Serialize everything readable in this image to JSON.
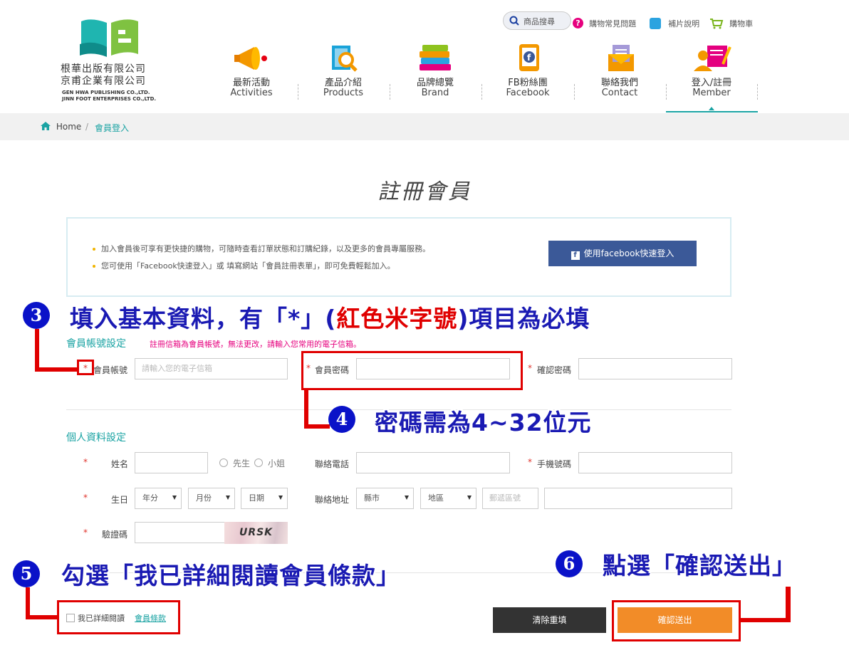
{
  "header": {
    "logo_zh_line1": "根華出版有限公司",
    "logo_zh_line2": "京甫企業有限公司",
    "logo_en_line1": "GEN HWA PUBLISHING CO.,LTD.",
    "logo_en_line2": "JINN FOOT ENTERPRISES CO.,LTD.",
    "search_placeholder": "商品搜尋",
    "top_links": [
      "購物常見問題",
      "補片說明",
      "購物車"
    ]
  },
  "nav": [
    {
      "zh": "最新活動",
      "en": "Activities",
      "icon": "megaphone-icon"
    },
    {
      "zh": "產品介紹",
      "en": "Products",
      "icon": "magnifier-book-icon"
    },
    {
      "zh": "品牌總覽",
      "en": "Brand",
      "icon": "books-icon"
    },
    {
      "zh": "FB粉絲團",
      "en": "Facebook",
      "icon": "facebook-phone-icon"
    },
    {
      "zh": "聯絡我們",
      "en": "Contact",
      "icon": "envelope-icon"
    },
    {
      "zh": "登入/註冊",
      "en": "Member",
      "icon": "member-icon"
    }
  ],
  "breadcrumb": {
    "home": "Home",
    "separator": "/",
    "current": "會員登入"
  },
  "page_title": "註冊會員",
  "info": {
    "bullets": [
      "加入會員後可享有更快捷的購物，可隨時查看訂單狀態和訂購紀錄，以及更多的會員專屬服務。",
      "您可使用「Facebook快速登入」或 填寫網站「會員註冊表單」，即可免費輕鬆加入。"
    ],
    "facebook_button": "使用facebook快速登入"
  },
  "account": {
    "section_title": "會員帳號設定",
    "note": "註冊信箱為會員帳號，無法更改，請輸入您常用的電子信箱。",
    "account_label": "會員帳號",
    "account_placeholder": "請輸入您的電子信箱",
    "password_label": "會員密碼",
    "confirm_label": "確認密碼"
  },
  "personal": {
    "section_title": "個人資料設定",
    "name_label": "姓名",
    "gender_options": [
      "先生",
      "小姐"
    ],
    "phone_label": "聯絡電話",
    "mobile_label": "手機號碼",
    "birthday_label": "生日",
    "year_select": "年分",
    "month_select": "月份",
    "day_select": "日期",
    "address_label": "聯絡地址",
    "city_select": "縣市",
    "district_select": "地區",
    "zip_placeholder": "郵遞區號",
    "captcha_label": "驗證碼",
    "captcha_text": "URSK"
  },
  "terms": {
    "text": "我已詳細閱讀",
    "link": "會員條款"
  },
  "buttons": {
    "clear": "清除重填",
    "submit": "確認送出"
  },
  "annotations": {
    "a3": {
      "num": "3",
      "text_before": "填入基本資料，有「*」(",
      "text_red": "紅色米字號",
      "text_after": ")項目為必填"
    },
    "a4": {
      "num": "4",
      "text": "密碼需為4~32位元"
    },
    "a5": {
      "num": "5",
      "text": "勾選「我已詳細閱讀會員條款」"
    },
    "a6": {
      "num": "6",
      "text": "點選「確認送出」"
    }
  },
  "colors": {
    "accent": "#1aa3a3",
    "facebook": "#3b5998",
    "submit": "#f28c28",
    "clear": "#333333",
    "annotation_blue": "#1a1ab3",
    "annotation_red": "#e00000"
  }
}
